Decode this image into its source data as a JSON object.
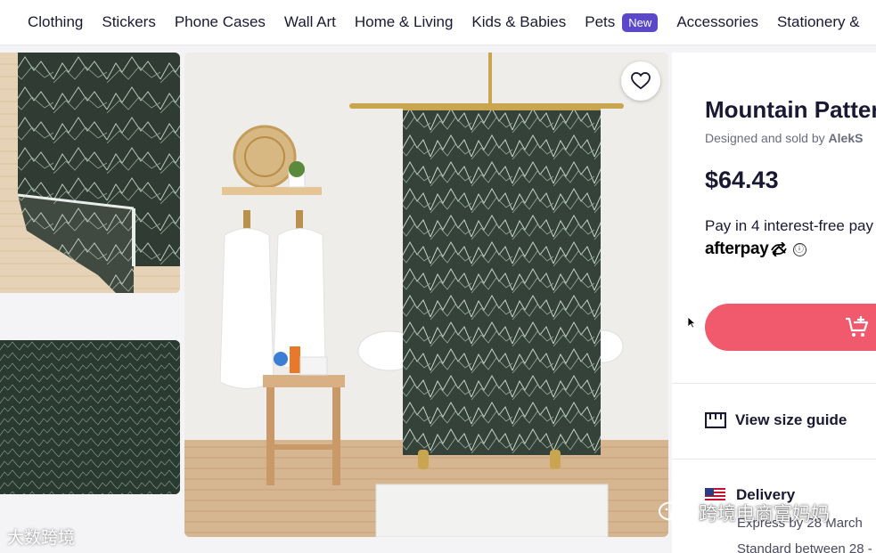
{
  "nav": {
    "items": [
      {
        "label": "Clothing"
      },
      {
        "label": "Stickers"
      },
      {
        "label": "Phone Cases"
      },
      {
        "label": "Wall Art"
      },
      {
        "label": "Home & Living"
      },
      {
        "label": "Kids & Babies"
      },
      {
        "label": "Pets",
        "badge": "New"
      },
      {
        "label": "Accessories"
      },
      {
        "label": "Stationery &"
      }
    ],
    "badge_color": "#5a48c8"
  },
  "gallery": {
    "thumb_1": "mountain-pattern-bath-mat-thumbnail",
    "thumb_2": "mountain-pattern-fabric-thumbnail",
    "main_image": "mountain-pattern-shower-curtain-photo",
    "favorite_icon": "heart-icon"
  },
  "product": {
    "title": "Mountain Patter",
    "designed_prefix": "Designed and sold by ",
    "designer": "AlekS",
    "price": "$64.43",
    "pay_in": "Pay in 4 interest-free pay",
    "afterpay_logo": "afterpay",
    "info_icon": "ⓘ",
    "cart_icon": "add-to-cart-icon",
    "size_guide": "View size guide",
    "delivery": "Delivery",
    "express": "Express by 28 March",
    "standard": "Standard between 28 -"
  },
  "colors": {
    "accent": "#f15a6c",
    "text": "#191933",
    "muted": "#6b6b80",
    "nav_badge": "#5a48c8"
  },
  "watermarks": {
    "left": "大数跨境",
    "right": "跨境电商富妈妈"
  }
}
